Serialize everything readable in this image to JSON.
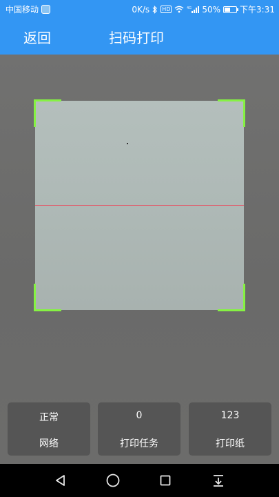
{
  "status_bar": {
    "carrier": "中国移动",
    "speed": "0K/s",
    "network_type": "4G",
    "hd_label": "HD",
    "battery": "50%",
    "battery_level": 0.5,
    "time": "下午3:31"
  },
  "header": {
    "back_label": "返回",
    "title": "扫码打印"
  },
  "cards": {
    "network": {
      "value": "正常",
      "label": "网络"
    },
    "tasks": {
      "value": "0",
      "label": "打印任务"
    },
    "paper": {
      "value": "123",
      "label": "打印纸"
    }
  },
  "nav": {
    "icons": [
      "back-triangle-icon",
      "home-circle-icon",
      "recent-square-icon",
      "notification-pull-down-icon"
    ]
  },
  "colors": {
    "brand_blue": "#3396f3",
    "scan_corner_green": "#86f243",
    "scan_line_red": "#e05a6a"
  }
}
